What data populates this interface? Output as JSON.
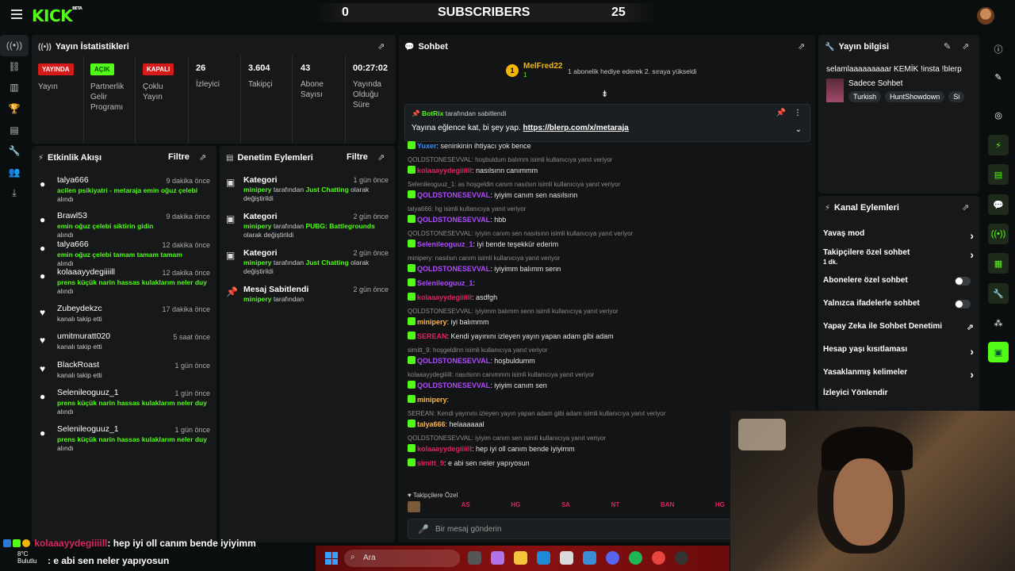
{
  "topbar": {
    "logo": "KICK",
    "logo_beta": "BETA",
    "sub_left": "0",
    "sub_title": "SUBSCRIBERS",
    "sub_right": "25"
  },
  "stats": {
    "title": "Yayın İstatistikleri",
    "live_badge": "YAYINDA",
    "live_label": "Yayın",
    "partner_badge": "AÇIK",
    "partner_label_1": "Partnerlik",
    "partner_label_2": "Gelir",
    "partner_label_3": "Programı",
    "multi_badge": "KAPALI",
    "multi_label_1": "Çoklu",
    "multi_label_2": "Yayın",
    "viewers": "26",
    "viewers_label": "İzleyici",
    "followers": "3.604",
    "followers_label": "Takipçi",
    "subs": "43",
    "subs_label_1": "Abone",
    "subs_label_2": "Sayısı",
    "uptime": "00:27:02",
    "uptime_label_1": "Yayında",
    "uptime_label_2": "Olduğu",
    "uptime_label_3": "Süre"
  },
  "activity": {
    "title": "Etkinlik Akışı",
    "filter": "Filtre",
    "items": [
      {
        "name": "talya666",
        "time": "9 dakika önce",
        "msg": "acilen psikiyatri - metaraja emin oğuz çelebi",
        "suffix": "alındı"
      },
      {
        "name": "Brawl53",
        "time": "9 dakika önce",
        "msg": "emin oğuz çelebi siktirin gidin",
        "suffix": "alındı"
      },
      {
        "name": "talya666",
        "time": "12 dakika önce",
        "msg": "emin oğuz çelebi tamam tamam tamam",
        "suffix": "alındı"
      },
      {
        "name": "kolaaayydegiiiill",
        "time": "12 dakika önce",
        "msg": "prens küçük narin hassas kulaklarım neler duy",
        "suffix": "alındı"
      },
      {
        "name": "Zubeydekzc",
        "time": "17 dakika önce",
        "msg": "",
        "suffix": "kanalı takip etti"
      },
      {
        "name": "umitmuratt020",
        "time": "5 saat önce",
        "msg": "",
        "suffix": "kanalı takip etti"
      },
      {
        "name": "BlackRoast",
        "time": "1 gün önce",
        "msg": "",
        "suffix": "kanalı takip etti"
      },
      {
        "name": "Selenileoguuz_1",
        "time": "1 gün önce",
        "msg": "prens küçük narin hassas kulaklarım neler duy",
        "suffix": "alındı"
      },
      {
        "name": "Selenileoguuz_1",
        "time": "1 gün önce",
        "msg": "prens küçük narin hassas kulaklarım neler duy",
        "suffix": "alındı"
      }
    ]
  },
  "moderation": {
    "title": "Denetim Eylemleri",
    "filter": "Filtre",
    "items": [
      {
        "title": "Kategori",
        "time": "1 gün önce",
        "user": "minipery",
        "mid": "tarafından",
        "value": "Just Chatting",
        "end": "olarak değiştirildi"
      },
      {
        "title": "Kategori",
        "time": "2 gün önce",
        "user": "minipery",
        "mid": "tarafından",
        "value": "PUBG: Battlegrounds",
        "end": "olarak değiştirildi"
      },
      {
        "title": "Kategori",
        "time": "2 gün önce",
        "user": "minipery",
        "mid": "tarafından",
        "value": "Just Chatting",
        "end": "olarak değiştirildi"
      },
      {
        "title": "Mesaj Sabitlendi",
        "time": "2 gün önce",
        "user": "minipery",
        "mid": "tarafından",
        "value": "",
        "end": ""
      }
    ]
  },
  "chat": {
    "title": "Sohbet",
    "gift_user": "MelFred22",
    "gift_level": "1",
    "gift_text": "1 abonelik hediye ederek 2. sıraya yükseldi",
    "pinned_by": "BotRix",
    "pinned_by_suffix": "tarafından sabitlendi",
    "pinned_msg": "Yayına eğlence kat, bi şey yap.",
    "pinned_link": "https://blerp.com/x/metaraja",
    "lines": [
      {
        "reply": "",
        "user": "Yuxer",
        "color": "blue",
        "text": ": seninkinin ihtiyacı yok bence"
      },
      {
        "reply": "QOLDSTONESEVVAL: hoşbuldum balımm isimli kullanıcıya yanıt veriyor",
        "user": "",
        "color": "",
        "text": ""
      },
      {
        "reply": "",
        "user": "kolaaayydegiiiill",
        "color": "red",
        "text": ": nasılsınn canımmm"
      },
      {
        "reply": "Selenileoguuz_1: as hoşgeldin canım nasılsın isimli kullanıcıya yanıt veriyor",
        "user": "",
        "color": "",
        "text": ""
      },
      {
        "reply": "",
        "user": "QOLDSTONESEVVAL",
        "color": "purple",
        "text": ": iyiyim canım sen nasılsınn"
      },
      {
        "reply": "talya666: hg isimli kullanıcıya yanıt veriyor",
        "user": "",
        "color": "",
        "text": ""
      },
      {
        "reply": "",
        "user": "QOLDSTONESEVVAL",
        "color": "purple",
        "text": ": hbb"
      },
      {
        "reply": "QOLDSTONESEVVAL: iyiyim canım sen nasılsınn isimli kullanıcıya yanıt veriyor",
        "user": "",
        "color": "",
        "text": ""
      },
      {
        "reply": "",
        "user": "Selenileoguuz_1",
        "color": "purple",
        "text": ": iyi bende teşekkür ederim"
      },
      {
        "reply": "minipery: nasılsın canım isimli kullanıcıya yanıt veriyor",
        "user": "",
        "color": "",
        "text": ""
      },
      {
        "reply": "",
        "user": "QOLDSTONESEVVAL",
        "color": "purple",
        "text": ": iyiyimm balımm senn"
      },
      {
        "reply": "",
        "user": "Selenileoguuz_1",
        "color": "purple",
        "text": ":"
      },
      {
        "reply": "",
        "user": "kolaaayydegiiiill",
        "color": "red",
        "text": ": asdfgh"
      },
      {
        "reply": "QOLDSTONESEVVAL: iyiyimm balımm senn isimli kullanıcıya yanıt veriyor",
        "user": "",
        "color": "",
        "text": ""
      },
      {
        "reply": "",
        "user": "minipery",
        "color": "orange",
        "text": ": iyi balımmm"
      },
      {
        "reply": "",
        "user": "SEREAN",
        "color": "red",
        "text": ": Kendi yayınını izleyen yayın yapan adam gibi adam"
      },
      {
        "reply": "simitt_9: hoşgeldinn isimli kullanıcıya yanıt veriyor",
        "user": "",
        "color": "",
        "text": ""
      },
      {
        "reply": "",
        "user": "QOLDSTONESEVVAL",
        "color": "purple",
        "text": ": hoşbuldumm"
      },
      {
        "reply": "kolaaayydegiiiill: nasılsınn canımmm isimli kullanıcıya yanıt veriyor",
        "user": "",
        "color": "",
        "text": ""
      },
      {
        "reply": "",
        "user": "QOLDSTONESEVVAL",
        "color": "purple",
        "text": ": iyiyim canım sen"
      },
      {
        "reply": "",
        "user": "minipery",
        "color": "orange",
        "text": ":"
      },
      {
        "reply": "SEREAN: Kendi yayınını izleyen yayın yapan adam gibi adam isimli kullanıcıya yanıt veriyor",
        "user": "",
        "color": "",
        "text": ""
      },
      {
        "reply": "",
        "user": "talya666",
        "color": "orange",
        "text": ": helaaaaaal"
      },
      {
        "reply": "QOLDSTONESEVVAL: iyiyim canım sen isimli kullanıcıya yanıt veriyor",
        "user": "",
        "color": "",
        "text": ""
      },
      {
        "reply": "",
        "user": "kolaaayydegiiiill",
        "color": "red",
        "text": ": hep iyi oll canım bende iyiyimm"
      },
      {
        "reply": "",
        "user": "simitt_9",
        "color": "red",
        "text": ": e abi sen neler yapıyosun"
      }
    ],
    "followers_only": "Takipçilere Özel",
    "emotes": [
      "AS",
      "HG",
      "SA",
      "NT",
      "BAN",
      "HG"
    ],
    "input_placeholder": "Bir mesaj gönderin"
  },
  "streaminfo": {
    "title": "Yayın bilgisi",
    "stream_title": "selamlaaaaaaaaar KEMİK !insta !blerp",
    "category": "Sadece Sohbet",
    "tags": [
      "Turkish",
      "HuntShowdown",
      "Si"
    ]
  },
  "channel_actions": {
    "title": "Kanal Eylemleri",
    "items": [
      {
        "label": "Yavaş mod",
        "sub": "",
        "control": "chevron"
      },
      {
        "label": "Takipçilere özel sohbet",
        "sub": "1 dk.",
        "control": "chevron"
      },
      {
        "label": "Abonelere özel sohbet",
        "sub": "",
        "control": "toggle"
      },
      {
        "label": "Yalnızca ifadelerle sohbet",
        "sub": "",
        "control": "toggle"
      },
      {
        "label": "Yapay Zeka ile Sohbet Denetimi",
        "sub": "",
        "control": "external"
      },
      {
        "label": "Hesap yaşı kısıtlaması",
        "sub": "",
        "control": "chevron"
      },
      {
        "label": "Yasaklanmış kelimeler",
        "sub": "",
        "control": "chevron"
      },
      {
        "label": "İzleyici Yönlendir",
        "sub": "",
        "control": "none"
      }
    ]
  },
  "overlay": {
    "line1_user": "kolaaayydegiiiill",
    "line1_text": ": hep iyi oll canım bende iyiyimm",
    "line2_text": ": e abi sen neler yapıyosun",
    "weather_temp": "8°C",
    "weather_desc": "Bulutlu"
  },
  "taskbar": {
    "search_placeholder": "Ara"
  },
  "colors": {
    "kick_green": "#53fc18",
    "live_red": "#d51a1a",
    "username_purple": "#b04bff",
    "username_red": "#e0245e"
  }
}
